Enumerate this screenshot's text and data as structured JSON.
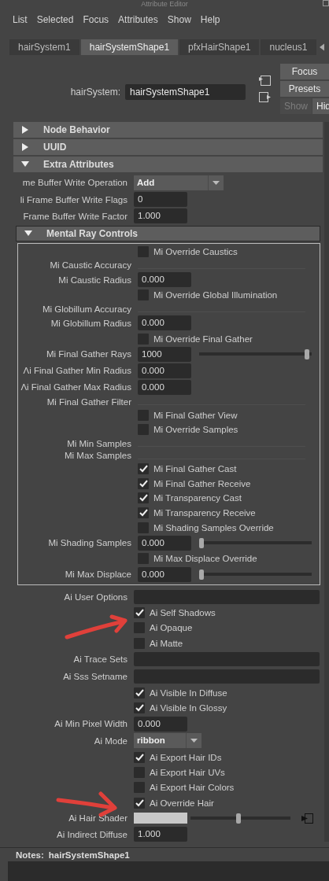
{
  "window": {
    "title": "Attribute Editor"
  },
  "menu": [
    "List",
    "Selected",
    "Focus",
    "Attributes",
    "Show",
    "Help"
  ],
  "tabs": [
    {
      "label": "hairSystem1",
      "selected": false
    },
    {
      "label": "hairSystemShape1",
      "selected": true
    },
    {
      "label": "pfxHairShape1",
      "selected": false
    },
    {
      "label": "nucleus1",
      "selected": false
    }
  ],
  "node": {
    "label": "hairSystem:",
    "value": "hairSystemShape1"
  },
  "buttons": [
    "Focus",
    "Presets"
  ],
  "show_hide": [
    {
      "label": "Show",
      "selected": false
    },
    {
      "label": "Hid",
      "selected": true
    }
  ],
  "sections": [
    {
      "title": "Node Behavior",
      "expanded": false
    },
    {
      "title": "UUID",
      "expanded": false
    },
    {
      "title": "Extra Attributes",
      "expanded": true,
      "rows": [
        {
          "kind": "dropdown",
          "label": "me Buffer Write Operation",
          "value": "Add"
        },
        {
          "kind": "field",
          "label": "li Frame Buffer Write Flags",
          "value": "0"
        },
        {
          "kind": "field",
          "label": "Frame Buffer Write Factor",
          "value": "1.000"
        },
        {
          "kind": "group",
          "title": "Mental Ray Controls",
          "expanded": true,
          "rows": [
            {
              "kind": "check",
              "label": "Mi Override Caustics",
              "checked": false
            },
            {
              "kind": "label",
              "label": "Mi Caustic Accuracy"
            },
            {
              "kind": "field",
              "label": "Mi Caustic Radius",
              "value": "0.000"
            },
            {
              "kind": "check",
              "label": "Mi Override Global Illumination",
              "checked": false
            },
            {
              "kind": "label",
              "label": "Mi Globillum Accuracy"
            },
            {
              "kind": "field",
              "label": "Mi Globillum Radius",
              "value": "0.000"
            },
            {
              "kind": "check",
              "label": "Mi Override Final Gather",
              "checked": false
            },
            {
              "kind": "slider",
              "label": "Mi Final Gather Rays",
              "value": "1000",
              "level": 0.98
            },
            {
              "kind": "field",
              "label": "Λi Final Gather Min Radius",
              "value": "0.000"
            },
            {
              "kind": "field",
              "label": "Λi Final Gather Max Radius",
              "value": "0.000"
            },
            {
              "kind": "label",
              "label": "Mi Final Gather Filter"
            },
            {
              "kind": "check",
              "label": "Mi Final Gather View",
              "checked": false
            },
            {
              "kind": "check",
              "label": "Mi Override Samples",
              "checked": false
            },
            {
              "kind": "label",
              "label": "Mi Min Samples"
            },
            {
              "kind": "label",
              "label": "Mi Max Samples"
            },
            {
              "kind": "check",
              "label": "Mi Final Gather Cast",
              "checked": true
            },
            {
              "kind": "check",
              "label": "Mi Final Gather Receive",
              "checked": true
            },
            {
              "kind": "check",
              "label": "Mi Transparency Cast",
              "checked": true
            },
            {
              "kind": "check",
              "label": "Mi Transparency Receive",
              "checked": true
            },
            {
              "kind": "check",
              "label": "Mi Shading Samples Override",
              "checked": false
            },
            {
              "kind": "slider",
              "label": "Mi Shading Samples",
              "value": "0.000",
              "level": 0
            },
            {
              "kind": "check",
              "label": "Mi Max Displace Override",
              "checked": false
            },
            {
              "kind": "slider",
              "label": "Mi Max Displace",
              "value": "0.000",
              "level": 0
            }
          ]
        },
        {
          "kind": "text",
          "label": "Ai User Options"
        },
        {
          "kind": "check",
          "label": "Ai Self Shadows",
          "checked": true
        },
        {
          "kind": "check",
          "label": "Ai Opaque",
          "checked": false
        },
        {
          "kind": "check",
          "label": "Ai Matte",
          "checked": false
        },
        {
          "kind": "text",
          "label": "Ai Trace Sets"
        },
        {
          "kind": "text",
          "label": "Ai Sss Setname"
        },
        {
          "kind": "check",
          "label": "Ai Visible In Diffuse",
          "checked": true
        },
        {
          "kind": "check",
          "label": "Ai Visible In Glossy",
          "checked": true
        },
        {
          "kind": "field",
          "label": "Ai Min Pixel Width",
          "value": "0.000"
        },
        {
          "kind": "dropdown",
          "label": "Ai Mode",
          "value": "ribbon"
        },
        {
          "kind": "check",
          "label": "Ai Export Hair IDs",
          "checked": true
        },
        {
          "kind": "check",
          "label": "Ai Export Hair UVs",
          "checked": false
        },
        {
          "kind": "check",
          "label": "Ai Export Hair Colors",
          "checked": false
        },
        {
          "kind": "check",
          "label": "Ai Override Hair",
          "checked": true
        },
        {
          "kind": "color",
          "label": "Ai Hair Shader",
          "level": 0.48
        },
        {
          "kind": "field",
          "label": "Ai Indirect Diffuse",
          "value": "1.000"
        }
      ]
    }
  ],
  "notes": {
    "label": "Notes:",
    "node": "hairSystemShape1"
  }
}
